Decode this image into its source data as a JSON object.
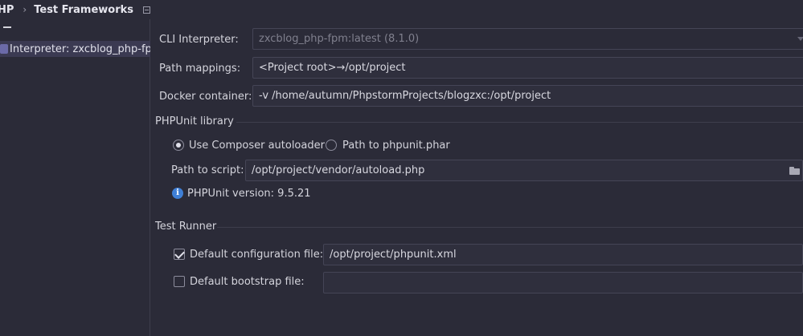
{
  "breadcrumb": {
    "parent": "HP",
    "separator": "›",
    "current": "Test Frameworks"
  },
  "left_panel": {
    "interpreter_item": "Interpreter: zxcblog_php-fpm"
  },
  "cli_interpreter": {
    "label": "CLI Interpreter:",
    "value": "zxcblog_php-fpm:latest (8.1.0)"
  },
  "path_mappings": {
    "label": "Path mappings:",
    "value": "<Project root>→/opt/project"
  },
  "docker_container": {
    "label": "Docker container:",
    "value": "-v /home/autumn/PhpstormProjects/blogzxc:/opt/project"
  },
  "phpunit_library": {
    "title": "PHPUnit library",
    "option_composer": "Use Composer autoloader",
    "option_phar": "Path to phpunit.phar",
    "selected": "composer",
    "script_label": "Path to script:",
    "script_value": "/opt/project/vendor/autoload.php",
    "version_text": "PHPUnit version: 9.5.21"
  },
  "test_runner": {
    "title": "Test Runner",
    "default_config_label": "Default configuration file:",
    "default_config_checked": true,
    "default_config_value": "/opt/project/phpunit.xml",
    "default_bootstrap_label": "Default bootstrap file:",
    "default_bootstrap_checked": false,
    "default_bootstrap_value": ""
  },
  "colors": {
    "background": "#2b2b38",
    "selection": "#3b3a52",
    "info_accent": "#3f7fd6"
  }
}
